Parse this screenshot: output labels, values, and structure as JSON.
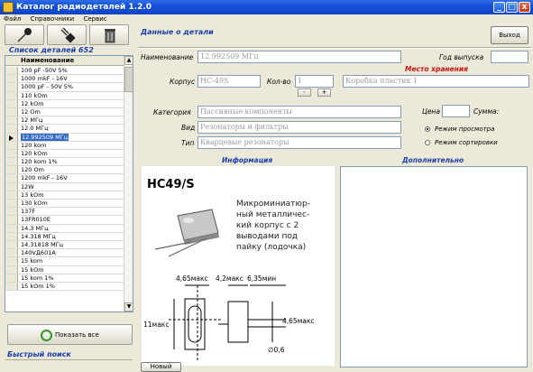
{
  "window": {
    "title": "Каталог радиодеталей 1.2.0",
    "min": "_",
    "max": "□",
    "close": "x"
  },
  "menu": [
    "Файл",
    "Справочники",
    "Сервис"
  ],
  "left": {
    "list_title": "Список деталей 652",
    "column_header": "Наименование",
    "rows": [
      "100 pF -50V 5%",
      "1000 mkF - 16V",
      "1000 pF - 50V 5%",
      "110 kOm",
      "12 kOm",
      "12 Om",
      "12 МГц",
      "12.0 МГц",
      "12.992509 МГц",
      "120 kom",
      "120 kOm",
      "120 kom 1%",
      "120 Om",
      "1200 mkF - 16V",
      "12W",
      "13 kOm",
      "130 kOm",
      "137F",
      "13FR010E",
      "14.3 МГц",
      "14.318 МГц",
      "14.31818 МГц",
      "140VД601A",
      "15 kom",
      "15 kOm",
      "15 kom 1%",
      "15 kOm 1%"
    ],
    "selected_index": 8,
    "show_all": "Показать все",
    "quick_search": "Быстрый поиск"
  },
  "right": {
    "section_title": "Данные о детали",
    "exit": "Выход",
    "labels": {
      "name": "Наименование",
      "year": "Год выпуска",
      "storage": "Место хранения",
      "case": "Корпус",
      "qty": "Кол-во",
      "category": "Категория",
      "kind": "Вид",
      "type": "Тип",
      "price": "Цена",
      "sum": "Сумма:",
      "info": "Информация",
      "extra": "Дополнительно"
    },
    "values": {
      "name": "12.992509 МГц",
      "year": "",
      "case": "HC-49S",
      "qty": "1",
      "storage": "Коробка пластик 1",
      "category": "Пассивные компоненты",
      "kind": "Резонаторы и фильтры",
      "type": "Кварцевые резонаторы",
      "price": ""
    },
    "spin_minus": "-",
    "spin_plus": "+",
    "radio_view": "Режим просмотра",
    "radio_sort": "Режим сортировки",
    "new_tab": "Новый"
  },
  "figure": {
    "model": "HC49/S",
    "desc": [
      "Микроминиатюр-",
      "ный металличес-",
      "кий корпус с 2",
      "выводами под",
      "пайку (лодочка)"
    ],
    "dims": [
      "4,65макс",
      "4,2макс",
      "6,35мин",
      "11макс",
      "4,65макс",
      "∅0,6"
    ]
  }
}
